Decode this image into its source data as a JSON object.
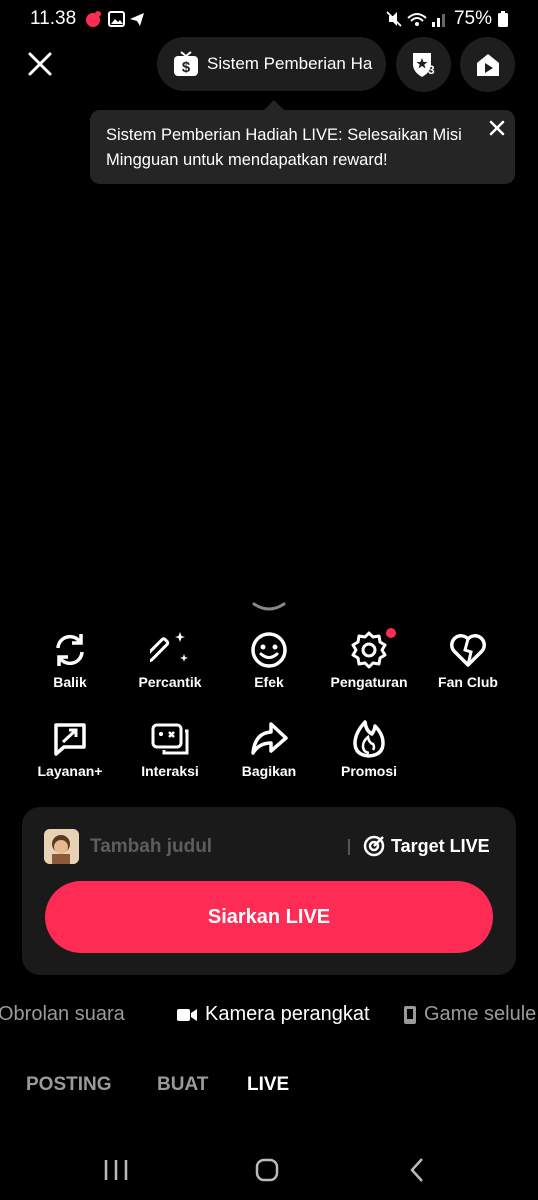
{
  "status_bar": {
    "time": "11.38",
    "battery": "75%"
  },
  "header": {
    "gift_pill_label": "Sistem Pemberian Ha",
    "rank_badge": "3"
  },
  "tooltip": {
    "text": "Sistem Pemberian Hadiah LIVE: Selesaikan Misi Mingguan untuk mendapatkan reward!"
  },
  "tools_row1": [
    {
      "label": "Balik",
      "icon": "flip-icon"
    },
    {
      "label": "Percantik",
      "icon": "magic-wand-icon"
    },
    {
      "label": "Efek",
      "icon": "smiley-icon"
    },
    {
      "label": "Pengaturan",
      "icon": "gear-icon"
    },
    {
      "label": "Fan Club",
      "icon": "heart-icon"
    }
  ],
  "tools_row2": [
    {
      "label": "Layanan+",
      "icon": "arrow-box-icon"
    },
    {
      "label": "Interaksi",
      "icon": "interaction-icon"
    },
    {
      "label": "Bagikan",
      "icon": "share-icon"
    },
    {
      "label": "Promosi",
      "icon": "flame-icon"
    }
  ],
  "panel": {
    "title_placeholder": "Tambah judul",
    "target_label": "Target LIVE",
    "go_live_label": "Siarkan LIVE"
  },
  "modes": [
    "Obrolan suara",
    "Kamera perangkat",
    "Game selule"
  ],
  "tabs": [
    "POSTING",
    "BUAT",
    "LIVE"
  ],
  "colors": {
    "accent": "#fe2c55",
    "panel": "#1a1a1a"
  }
}
